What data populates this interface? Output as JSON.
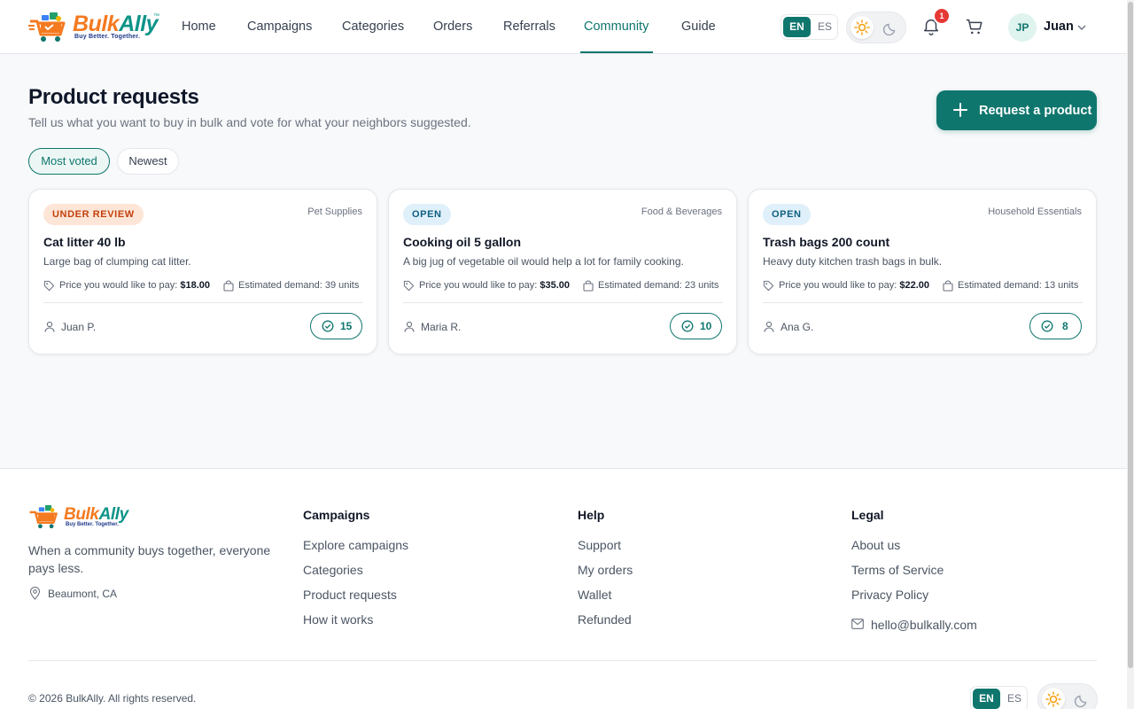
{
  "brand": {
    "name_part1": "Bulk",
    "name_part2": "Ally",
    "trademark": "™",
    "tagline": "Buy Better. Together."
  },
  "nav": {
    "items": [
      {
        "label": "Home"
      },
      {
        "label": "Campaigns"
      },
      {
        "label": "Categories"
      },
      {
        "label": "Orders"
      },
      {
        "label": "Referrals"
      },
      {
        "label": "Community",
        "active": true
      },
      {
        "label": "Guide"
      }
    ]
  },
  "header": {
    "lang_en": "EN",
    "lang_es": "ES",
    "notification_count": "1",
    "user_initials": "JP",
    "user_name": "Juan"
  },
  "page": {
    "title": "Product requests",
    "subtitle": "Tell us what you want to buy in bulk and vote for what your neighbors suggested.",
    "request_button": "Request a product",
    "sort_options": [
      "Most voted",
      "Newest"
    ],
    "sort_selected": "Most voted"
  },
  "requests": [
    {
      "status": "UNDER REVIEW",
      "category": "Pet Supplies",
      "title": "Cat litter 40 lb",
      "description": "Large bag of clumping cat litter.",
      "price_label": "Price you would like to pay: ",
      "price": "$18.00",
      "demand": "Estimated demand: 39 units",
      "author": "Juan P.",
      "votes": "15"
    },
    {
      "status": "OPEN",
      "category": "Food & Beverages",
      "title": "Cooking oil 5 gallon",
      "description": "A big jug of vegetable oil would help a lot for family cooking.",
      "price_label": "Price you would like to pay: ",
      "price": "$35.00",
      "demand": "Estimated demand: 23 units",
      "author": "Maria R.",
      "votes": "10"
    },
    {
      "status": "OPEN",
      "category": "Household Essentials",
      "title": "Trash bags 200 count",
      "description": "Heavy duty kitchen trash bags in bulk.",
      "price_label": "Price you would like to pay: ",
      "price": "$22.00",
      "demand": "Estimated demand: 13 units",
      "author": "Ana G.",
      "votes": "8"
    }
  ],
  "footer": {
    "description": "When a community buys together, everyone pays less.",
    "location": "Beaumont, CA",
    "columns": [
      {
        "heading": "Campaigns",
        "links": [
          "Explore campaigns",
          "Categories",
          "Product requests",
          "How it works"
        ]
      },
      {
        "heading": "Help",
        "links": [
          "Support",
          "My orders",
          "Wallet",
          "Refunded"
        ]
      },
      {
        "heading": "Legal",
        "links": [
          "About us",
          "Terms of Service",
          "Privacy Policy"
        ]
      }
    ],
    "email": "hello@bulkally.com",
    "copyright": "© 2026 BulkAlly. All rights reserved.",
    "lang_en": "EN",
    "lang_es": "ES"
  },
  "colors": {
    "primary": "#0f766e",
    "brand_orange": "#f47a20",
    "badge_red": "#e53935",
    "review_bg": "#fde5d8",
    "open_bg": "#e0f0fa"
  },
  "icons": [
    "logo-cart-icon",
    "sun-icon",
    "moon-icon",
    "bell-icon",
    "cart-icon",
    "chevron-down-icon",
    "plus-icon",
    "tag-icon",
    "shopping-bag-icon",
    "user-icon",
    "check-circle-icon",
    "map-pin-icon",
    "mail-icon"
  ]
}
